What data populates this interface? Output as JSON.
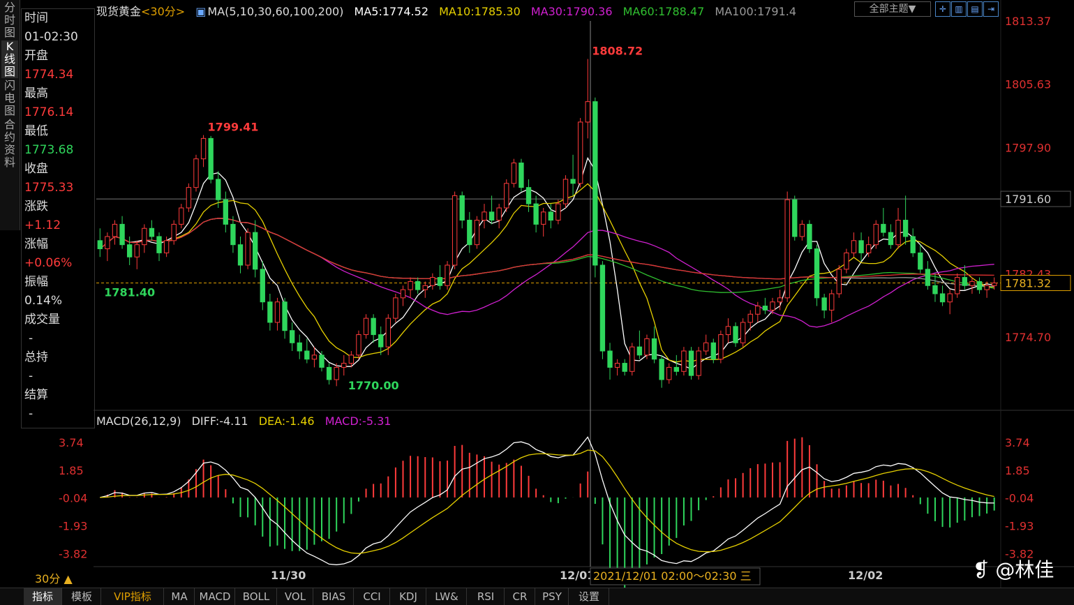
{
  "left_tabs": [
    "分时图",
    "K线图",
    "闪电图",
    "合约资料"
  ],
  "info": {
    "time_label": "时间",
    "time": "01-02:30",
    "open_label": "开盘",
    "open": "1774.34",
    "high_label": "最高",
    "high": "1776.14",
    "low_label": "最低",
    "low": "1773.68",
    "close_label": "收盘",
    "close": "1775.33",
    "change_label": "涨跌",
    "change": "+1.12",
    "pct_label": "涨幅",
    "pct": "+0.06%",
    "amp_label": "振幅",
    "amp": "0.14%",
    "vol_label": "成交量",
    "vol": "-",
    "hold_label": "总持",
    "hold": "-",
    "settle_label": "结算",
    "settle": "-"
  },
  "header": {
    "instrument": "现货黄金",
    "period": "<30分>",
    "ma_def": "MA(5,10,30,60,100,200)",
    "ma5": "MA5:1774.52",
    "ma10": "MA10:1785.30",
    "ma30": "MA30:1790.36",
    "ma60": "MA60:1788.47",
    "ma100": "MA100:1791.4",
    "theme": "全部主题▼"
  },
  "macd_header": {
    "def": "MACD(26,12,9)",
    "diff": "DIFF:-4.11",
    "dea": "DEA:-1.46",
    "macd": "MACD:-5.31"
  },
  "colors": {
    "up": "#ff3b3b",
    "down": "#2fd65c",
    "ma5": "#ffffff",
    "ma10": "#e6d000",
    "ma30": "#d020d0",
    "ma60": "#30c030",
    "ma100": "#999999",
    "ma200": "#e03030"
  },
  "bottom_tabs": [
    "指标",
    "模板",
    "VIP指标",
    "MA",
    "MACD",
    "BOLL",
    "VOL",
    "BIAS",
    "CCI",
    "KDJ",
    "LW&",
    "RSI",
    "CR",
    "PSY",
    "设置"
  ],
  "period_button": "30分 ▲",
  "watermark": "@林佳",
  "chart_data": {
    "type": "candlestick",
    "price_axis_ticks": [
      "1813.37",
      "1805.63",
      "1797.90",
      "1782.43",
      "1774.70"
    ],
    "marked_levels": [
      "1791.60",
      "1781.32"
    ],
    "annotations": {
      "high1": "1799.41",
      "high2": "1808.72",
      "low1": "1781.40",
      "low2": "1770.00"
    },
    "macd_axis_ticks": [
      "3.74",
      "1.85",
      "-0.04",
      "-1.93",
      "-3.82"
    ],
    "x_labels": [
      "11/30",
      "12/01",
      "12/02"
    ],
    "cursor_label": "2021/12/01  02:00～02:30 三",
    "candles": [
      [
        1786.5,
        1788.0,
        1784.5,
        1785.5
      ],
      [
        1785.5,
        1787.5,
        1784.0,
        1787.0
      ],
      [
        1787.0,
        1789.0,
        1786.0,
        1788.5
      ],
      [
        1788.5,
        1789.5,
        1785.5,
        1786.0
      ],
      [
        1786.0,
        1787.0,
        1783.5,
        1784.5
      ],
      [
        1784.5,
        1786.5,
        1783.0,
        1786.0
      ],
      [
        1786.0,
        1788.5,
        1785.0,
        1788.0
      ],
      [
        1788.0,
        1789.0,
        1786.5,
        1787.0
      ],
      [
        1787.0,
        1787.5,
        1784.0,
        1785.0
      ],
      [
        1785.0,
        1787.0,
        1784.5,
        1786.5
      ],
      [
        1786.5,
        1789.0,
        1786.0,
        1788.5
      ],
      [
        1788.5,
        1791.0,
        1788.0,
        1790.5
      ],
      [
        1790.5,
        1793.5,
        1790.0,
        1793.0
      ],
      [
        1793.0,
        1797.0,
        1792.5,
        1796.5
      ],
      [
        1796.5,
        1799.41,
        1795.5,
        1799.0
      ],
      [
        1799.0,
        1799.3,
        1793.5,
        1794.0
      ],
      [
        1794.0,
        1795.0,
        1790.5,
        1791.5
      ],
      [
        1791.5,
        1792.5,
        1787.5,
        1788.5
      ],
      [
        1788.5,
        1789.5,
        1785.0,
        1786.0
      ],
      [
        1786.0,
        1787.0,
        1782.5,
        1783.5
      ],
      [
        1783.5,
        1788.0,
        1783.0,
        1787.5
      ],
      [
        1787.5,
        1789.0,
        1782.0,
        1783.0
      ],
      [
        1783.0,
        1784.0,
        1778.0,
        1779.0
      ],
      [
        1779.0,
        1780.0,
        1775.5,
        1776.5
      ],
      [
        1776.5,
        1779.5,
        1775.5,
        1779.0
      ],
      [
        1779.0,
        1779.5,
        1774.5,
        1775.5
      ],
      [
        1775.5,
        1776.5,
        1773.0,
        1774.0
      ],
      [
        1774.0,
        1775.0,
        1772.0,
        1773.0
      ],
      [
        1773.0,
        1774.5,
        1771.5,
        1772.0
      ],
      [
        1772.0,
        1773.5,
        1771.0,
        1772.5
      ],
      [
        1772.5,
        1773.0,
        1770.5,
        1771.0
      ],
      [
        1771.0,
        1771.5,
        1768.9,
        1769.5
      ],
      [
        1769.5,
        1771.5,
        1768.7,
        1771.0
      ],
      [
        1771.0,
        1772.5,
        1770.0,
        1771.5
      ],
      [
        1771.5,
        1773.0,
        1771.0,
        1772.5
      ],
      [
        1772.5,
        1775.5,
        1772.0,
        1775.0
      ],
      [
        1775.0,
        1777.5,
        1774.5,
        1777.0
      ],
      [
        1777.0,
        1777.5,
        1774.0,
        1775.0
      ],
      [
        1775.0,
        1776.0,
        1772.5,
        1773.5
      ],
      [
        1773.5,
        1777.5,
        1772.5,
        1777.0
      ],
      [
        1777.0,
        1780.0,
        1776.5,
        1779.5
      ],
      [
        1779.5,
        1781.0,
        1778.5,
        1780.5
      ],
      [
        1780.5,
        1782.0,
        1779.5,
        1781.5
      ],
      [
        1781.5,
        1782.0,
        1780.0,
        1780.5
      ],
      [
        1780.5,
        1781.5,
        1779.5,
        1781.0
      ],
      [
        1781.0,
        1782.5,
        1780.5,
        1782.0
      ],
      [
        1782.0,
        1783.5,
        1780.5,
        1781.0
      ],
      [
        1781.0,
        1784.0,
        1780.5,
        1783.5
      ],
      [
        1783.5,
        1792.5,
        1783.0,
        1792.0
      ],
      [
        1792.0,
        1792.5,
        1788.0,
        1789.0
      ],
      [
        1789.0,
        1790.0,
        1785.0,
        1786.0
      ],
      [
        1786.0,
        1789.5,
        1785.5,
        1789.0
      ],
      [
        1789.0,
        1791.0,
        1788.0,
        1790.0
      ],
      [
        1790.0,
        1792.0,
        1788.5,
        1789.0
      ],
      [
        1789.0,
        1791.0,
        1788.0,
        1790.5
      ],
      [
        1790.5,
        1794.0,
        1790.0,
        1793.5
      ],
      [
        1793.5,
        1796.5,
        1793.0,
        1796.0
      ],
      [
        1796.0,
        1796.5,
        1792.5,
        1793.0
      ],
      [
        1793.0,
        1794.0,
        1790.0,
        1791.0
      ],
      [
        1791.0,
        1792.0,
        1787.5,
        1788.5
      ],
      [
        1788.5,
        1790.5,
        1787.0,
        1790.0
      ],
      [
        1790.0,
        1791.0,
        1788.0,
        1789.0
      ],
      [
        1789.0,
        1791.5,
        1788.5,
        1791.0
      ],
      [
        1791.0,
        1794.5,
        1790.5,
        1794.0
      ],
      [
        1794.0,
        1797.0,
        1792.0,
        1793.5
      ],
      [
        1793.5,
        1801.5,
        1793.0,
        1801.0
      ],
      [
        1801.0,
        1808.72,
        1799.0,
        1803.5
      ],
      [
        1803.5,
        1804.0,
        1782.0,
        1783.5
      ],
      [
        1783.5,
        1784.0,
        1772.0,
        1773.0
      ],
      [
        1773.0,
        1774.0,
        1769.5,
        1771.0
      ],
      [
        1771.0,
        1772.0,
        1770.0,
        1771.5
      ],
      [
        1771.5,
        1772.0,
        1770.0,
        1770.5
      ],
      [
        1770.5,
        1774.0,
        1770.0,
        1773.5
      ],
      [
        1773.5,
        1775.5,
        1772.0,
        1772.5
      ],
      [
        1772.5,
        1775.0,
        1772.0,
        1774.5
      ],
      [
        1774.5,
        1776.0,
        1771.5,
        1772.0
      ],
      [
        1772.0,
        1772.5,
        1768.5,
        1769.5
      ],
      [
        1769.5,
        1771.5,
        1769.0,
        1771.0
      ],
      [
        1771.0,
        1772.5,
        1770.0,
        1770.5
      ],
      [
        1770.5,
        1773.5,
        1770.0,
        1773.0
      ],
      [
        1773.0,
        1773.5,
        1769.5,
        1770.0
      ],
      [
        1770.0,
        1773.5,
        1769.5,
        1773.0
      ],
      [
        1773.0,
        1775.0,
        1772.5,
        1774.0
      ],
      [
        1774.0,
        1774.5,
        1771.5,
        1772.0
      ],
      [
        1772.0,
        1775.5,
        1771.5,
        1775.0
      ],
      [
        1775.0,
        1777.0,
        1774.0,
        1776.0
      ],
      [
        1776.0,
        1776.5,
        1773.5,
        1774.0
      ],
      [
        1774.0,
        1777.0,
        1773.5,
        1776.5
      ],
      [
        1776.5,
        1778.0,
        1775.5,
        1777.5
      ],
      [
        1777.5,
        1779.0,
        1776.5,
        1778.5
      ],
      [
        1778.5,
        1779.5,
        1777.5,
        1778.0
      ],
      [
        1778.0,
        1779.5,
        1777.5,
        1779.0
      ],
      [
        1779.0,
        1780.5,
        1778.0,
        1779.5
      ],
      [
        1779.5,
        1792.5,
        1779.0,
        1791.5
      ],
      [
        1791.5,
        1792.0,
        1786.5,
        1787.0
      ],
      [
        1787.0,
        1789.0,
        1786.5,
        1788.5
      ],
      [
        1788.5,
        1789.0,
        1785.0,
        1785.5
      ],
      [
        1785.5,
        1786.0,
        1778.5,
        1779.5
      ],
      [
        1779.5,
        1780.0,
        1777.0,
        1778.0
      ],
      [
        1778.0,
        1780.5,
        1776.5,
        1780.0
      ],
      [
        1780.0,
        1783.5,
        1779.5,
        1783.0
      ],
      [
        1783.0,
        1785.5,
        1782.5,
        1785.0
      ],
      [
        1785.0,
        1787.5,
        1784.5,
        1786.5
      ],
      [
        1786.5,
        1787.5,
        1784.0,
        1785.0
      ],
      [
        1785.0,
        1787.0,
        1784.5,
        1786.0
      ],
      [
        1786.0,
        1789.0,
        1785.5,
        1788.5
      ],
      [
        1788.5,
        1790.5,
        1787.0,
        1787.5
      ],
      [
        1787.5,
        1788.5,
        1785.5,
        1786.0
      ],
      [
        1786.0,
        1790.5,
        1785.5,
        1789.0
      ],
      [
        1789.0,
        1792.0,
        1786.0,
        1787.0
      ],
      [
        1787.0,
        1788.0,
        1784.5,
        1785.0
      ],
      [
        1785.0,
        1786.0,
        1782.5,
        1783.0
      ],
      [
        1783.0,
        1784.0,
        1780.5,
        1781.0
      ],
      [
        1781.0,
        1782.5,
        1779.0,
        1780.0
      ],
      [
        1780.0,
        1781.0,
        1778.5,
        1779.0
      ],
      [
        1779.0,
        1780.5,
        1777.5,
        1780.0
      ],
      [
        1780.0,
        1782.5,
        1779.5,
        1782.0
      ],
      [
        1782.0,
        1783.5,
        1780.5,
        1781.0
      ],
      [
        1781.0,
        1782.0,
        1780.0,
        1781.5
      ],
      [
        1781.5,
        1782.0,
        1780.0,
        1780.5
      ],
      [
        1780.5,
        1781.5,
        1779.5,
        1781.0
      ],
      [
        1781.0,
        1782.0,
        1780.5,
        1781.32
      ]
    ]
  }
}
